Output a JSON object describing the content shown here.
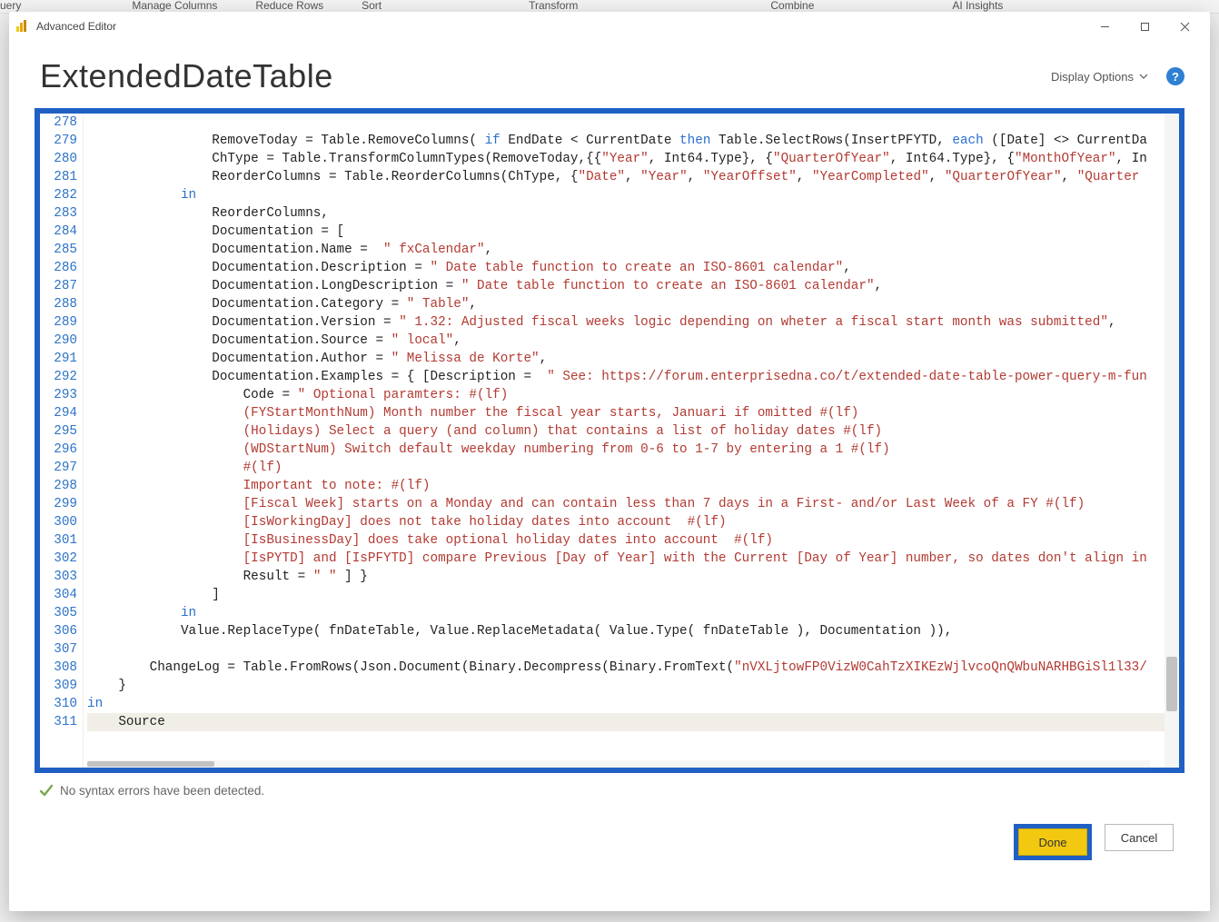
{
  "ribbon": {
    "groups": [
      "uery",
      "Manage Columns",
      "Reduce Rows",
      "Sort",
      "Transform",
      "Combine",
      "AI Insights"
    ]
  },
  "window": {
    "title": "Advanced Editor"
  },
  "header": {
    "page_title": "ExtendedDateTable",
    "display_options_label": "Display Options",
    "help_tooltip": "?"
  },
  "editor": {
    "first_line_number": 278,
    "lines": [
      {
        "n": 278,
        "segments": [
          {
            "t": "",
            "c": "plain"
          }
        ]
      },
      {
        "n": 279,
        "segments": [
          {
            "t": "                RemoveToday = Table.RemoveColumns( ",
            "c": "plain"
          },
          {
            "t": "if",
            "c": "kw"
          },
          {
            "t": " EndDate < CurrentDate ",
            "c": "plain"
          },
          {
            "t": "then",
            "c": "kw"
          },
          {
            "t": " Table.SelectRows(InsertPFYTD, ",
            "c": "plain"
          },
          {
            "t": "each",
            "c": "kw"
          },
          {
            "t": " (",
            "c": "plain"
          },
          {
            "t": "[Date]",
            "c": "plain"
          },
          {
            "t": " <> CurrentDa",
            "c": "plain"
          }
        ]
      },
      {
        "n": 280,
        "segments": [
          {
            "t": "                ChType = Table.TransformColumnTypes(RemoveToday,{{",
            "c": "plain"
          },
          {
            "t": "\"Year\"",
            "c": "str"
          },
          {
            "t": ", Int64.Type}, {",
            "c": "plain"
          },
          {
            "t": "\"QuarterOfYear\"",
            "c": "str"
          },
          {
            "t": ", Int64.Type}, {",
            "c": "plain"
          },
          {
            "t": "\"MonthOfYear\"",
            "c": "str"
          },
          {
            "t": ", In",
            "c": "plain"
          }
        ]
      },
      {
        "n": 281,
        "segments": [
          {
            "t": "                ReorderColumns = Table.ReorderColumns(ChType, {",
            "c": "plain"
          },
          {
            "t": "\"Date\"",
            "c": "str"
          },
          {
            "t": ", ",
            "c": "plain"
          },
          {
            "t": "\"Year\"",
            "c": "str"
          },
          {
            "t": ", ",
            "c": "plain"
          },
          {
            "t": "\"YearOffset\"",
            "c": "str"
          },
          {
            "t": ", ",
            "c": "plain"
          },
          {
            "t": "\"YearCompleted\"",
            "c": "str"
          },
          {
            "t": ", ",
            "c": "plain"
          },
          {
            "t": "\"QuarterOfYear\"",
            "c": "str"
          },
          {
            "t": ", ",
            "c": "plain"
          },
          {
            "t": "\"Quarter ",
            "c": "str"
          }
        ]
      },
      {
        "n": 282,
        "segments": [
          {
            "t": "            ",
            "c": "plain"
          },
          {
            "t": "in",
            "c": "kw"
          }
        ]
      },
      {
        "n": 283,
        "segments": [
          {
            "t": "                ReorderColumns,",
            "c": "plain"
          }
        ]
      },
      {
        "n": 284,
        "segments": [
          {
            "t": "                Documentation = [",
            "c": "plain"
          }
        ]
      },
      {
        "n": 285,
        "segments": [
          {
            "t": "                Documentation.Name =  ",
            "c": "plain"
          },
          {
            "t": "\" fxCalendar\"",
            "c": "str"
          },
          {
            "t": ",",
            "c": "plain"
          }
        ]
      },
      {
        "n": 286,
        "segments": [
          {
            "t": "                Documentation.Description = ",
            "c": "plain"
          },
          {
            "t": "\" Date table function to create an ISO-8601 calendar\"",
            "c": "str"
          },
          {
            "t": ",",
            "c": "plain"
          }
        ]
      },
      {
        "n": 287,
        "segments": [
          {
            "t": "                Documentation.LongDescription = ",
            "c": "plain"
          },
          {
            "t": "\" Date table function to create an ISO-8601 calendar\"",
            "c": "str"
          },
          {
            "t": ",",
            "c": "plain"
          }
        ]
      },
      {
        "n": 288,
        "segments": [
          {
            "t": "                Documentation.Category = ",
            "c": "plain"
          },
          {
            "t": "\" Table\"",
            "c": "str"
          },
          {
            "t": ",",
            "c": "plain"
          }
        ]
      },
      {
        "n": 289,
        "segments": [
          {
            "t": "                Documentation.Version = ",
            "c": "plain"
          },
          {
            "t": "\" 1.32: Adjusted fiscal weeks logic depending on wheter a fiscal start month was submitted\"",
            "c": "str"
          },
          {
            "t": ",",
            "c": "plain"
          }
        ]
      },
      {
        "n": 290,
        "segments": [
          {
            "t": "                Documentation.Source = ",
            "c": "plain"
          },
          {
            "t": "\" local\"",
            "c": "str"
          },
          {
            "t": ",",
            "c": "plain"
          }
        ]
      },
      {
        "n": 291,
        "segments": [
          {
            "t": "                Documentation.Author = ",
            "c": "plain"
          },
          {
            "t": "\" Melissa de Korte\"",
            "c": "str"
          },
          {
            "t": ",",
            "c": "plain"
          }
        ]
      },
      {
        "n": 292,
        "segments": [
          {
            "t": "                Documentation.Examples = { [Description =  ",
            "c": "plain"
          },
          {
            "t": "\" See: https://forum.enterprisedna.co/t/extended-date-table-power-query-m-fun",
            "c": "str"
          }
        ]
      },
      {
        "n": 293,
        "segments": [
          {
            "t": "                    Code = ",
            "c": "plain"
          },
          {
            "t": "\" Optional paramters: #(lf)",
            "c": "str"
          }
        ]
      },
      {
        "n": 294,
        "segments": [
          {
            "t": "                    (FYStartMonthNum) Month number the fiscal year starts, Januari if omitted #(lf)",
            "c": "str"
          }
        ]
      },
      {
        "n": 295,
        "segments": [
          {
            "t": "                    (Holidays) Select a query (and column) that contains a list of holiday dates #(lf)",
            "c": "str"
          }
        ]
      },
      {
        "n": 296,
        "segments": [
          {
            "t": "                    (WDStartNum) Switch default weekday numbering from 0-6 to 1-7 by entering a 1 #(lf)",
            "c": "str"
          }
        ]
      },
      {
        "n": 297,
        "segments": [
          {
            "t": "                    #(lf)",
            "c": "str"
          }
        ]
      },
      {
        "n": 298,
        "segments": [
          {
            "t": "                    Important to note: #(lf)",
            "c": "str"
          }
        ]
      },
      {
        "n": 299,
        "segments": [
          {
            "t": "                    [Fiscal Week] starts on a Monday and can contain less than 7 days in a First- and/or Last Week of a FY #(lf)",
            "c": "str"
          }
        ]
      },
      {
        "n": 300,
        "segments": [
          {
            "t": "                    [IsWorkingDay] does not take holiday dates into account  #(lf)",
            "c": "str"
          }
        ]
      },
      {
        "n": 301,
        "segments": [
          {
            "t": "                    [IsBusinessDay] does take optional holiday dates into account  #(lf)",
            "c": "str"
          }
        ]
      },
      {
        "n": 302,
        "segments": [
          {
            "t": "                    [IsPYTD] and [IsPFYTD] compare Previous [Day of Year] with the Current [Day of Year] number, so dates don't align in",
            "c": "str"
          }
        ]
      },
      {
        "n": 303,
        "segments": [
          {
            "t": "                    Result = ",
            "c": "plain"
          },
          {
            "t": "\" \"",
            "c": "str"
          },
          {
            "t": " ] }",
            "c": "plain"
          }
        ]
      },
      {
        "n": 304,
        "segments": [
          {
            "t": "                ]",
            "c": "plain"
          }
        ]
      },
      {
        "n": 305,
        "segments": [
          {
            "t": "            ",
            "c": "plain"
          },
          {
            "t": "in",
            "c": "kw"
          }
        ]
      },
      {
        "n": 306,
        "segments": [
          {
            "t": "            Value.ReplaceType( fnDateTable, Value.ReplaceMetadata( Value.Type( fnDateTable ), Documentation )),",
            "c": "plain"
          }
        ]
      },
      {
        "n": 307,
        "segments": [
          {
            "t": "",
            "c": "plain"
          }
        ]
      },
      {
        "n": 308,
        "segments": [
          {
            "t": "        ChangeLog = Table.FromRows(Json.Document(Binary.Decompress(Binary.FromText(",
            "c": "plain"
          },
          {
            "t": "\"nVXLjtowFP0VizW0CahTzXIKEzWjlvcoQnQWbuNARHBGiSl1l33/",
            "c": "str"
          }
        ]
      },
      {
        "n": 309,
        "segments": [
          {
            "t": "    }",
            "c": "plain"
          }
        ]
      },
      {
        "n": 310,
        "segments": [
          {
            "t": "",
            "c": "plain"
          },
          {
            "t": "in",
            "c": "kw"
          }
        ]
      },
      {
        "n": 311,
        "current": true,
        "segments": [
          {
            "t": "    Source",
            "c": "plain"
          }
        ]
      }
    ]
  },
  "status": {
    "message": "No syntax errors have been detected."
  },
  "footer": {
    "done_label": "Done",
    "cancel_label": "Cancel"
  }
}
